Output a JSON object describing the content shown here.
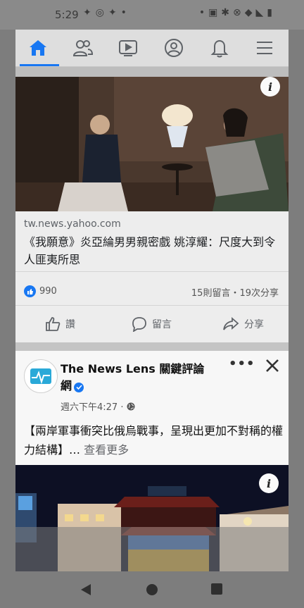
{
  "status_bar": {
    "time": "5:29"
  },
  "nav": {
    "items": [
      {
        "name": "home",
        "active": true
      },
      {
        "name": "friends",
        "active": false
      },
      {
        "name": "watch",
        "active": false
      },
      {
        "name": "profile",
        "active": false
      },
      {
        "name": "notifications",
        "active": false
      },
      {
        "name": "menu",
        "active": false
      }
    ],
    "accent_color": "#1877f2"
  },
  "post1": {
    "link_domain": "tw.news.yahoo.com",
    "link_title": "《我願意》炎亞綸男男親密戲 姚淳耀：尺度大到令人匪夷所思",
    "reaction_count": "990",
    "stats": "15則留言・19次分享",
    "actions": {
      "like": "讚",
      "comment": "留言",
      "share": "分享"
    }
  },
  "post2": {
    "page_name": "The News Lens 關鍵評論網",
    "time": "週六下午4:27 ·",
    "text": "【兩岸軍事衝突比俄烏戰事，呈現出更加不對稱的權力結構】…",
    "see_more": "查看更多"
  }
}
